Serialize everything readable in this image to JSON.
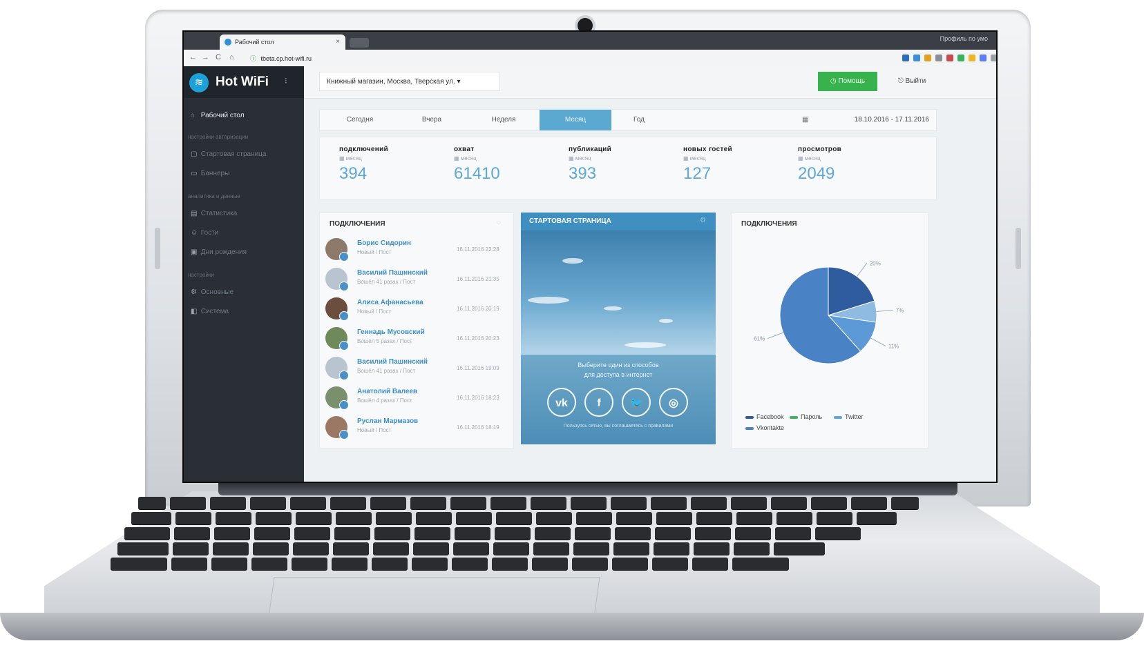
{
  "browser": {
    "tab_title": "Рабочий стол",
    "tab_close": "×",
    "profile": "Профиль по умо",
    "url": "tbeta.cp.hot-wifi.ru",
    "url_lock": "ⓘ",
    "nav": {
      "back": "←",
      "forward": "→",
      "reload": "C",
      "home": "⌂"
    },
    "extension_colors": [
      "#2d6db8",
      "#3b8fd9",
      "#e0a020",
      "#8a8f96",
      "#c94a4a",
      "#3db05b",
      "#f0b429",
      "#5c7cfa",
      "#9aa0a6"
    ]
  },
  "sidebar": {
    "logo_text": "Hot WiFi",
    "logo_icon": "wifi-icon",
    "menu_toggle": "⁝",
    "items": [
      {
        "label": "Рабочий стол",
        "icon": "home-icon",
        "active": true
      },
      {
        "section": "настройки авторизации"
      },
      {
        "label": "Стартовая страница",
        "icon": "page-icon"
      },
      {
        "label": "Баннеры",
        "icon": "banner-icon"
      },
      {
        "section": "аналитика и данные"
      },
      {
        "label": "Статистика",
        "icon": "chart-icon"
      },
      {
        "label": "Гости",
        "icon": "users-icon"
      },
      {
        "label": "Дни рождения",
        "icon": "cake-icon"
      },
      {
        "section": "настройки"
      },
      {
        "label": "Основные",
        "icon": "settings-icon"
      },
      {
        "label": "Система",
        "icon": "system-icon"
      }
    ]
  },
  "topbar": {
    "store_select": "Книжный магазин, Москва, Тверская ул.",
    "help_button": "Помощь",
    "logout_button": "Выйти"
  },
  "period": {
    "tabs": [
      "Сегодня",
      "Вчера",
      "Неделя",
      "Месяц",
      "Год"
    ],
    "active_tab": "Месяц",
    "date_range": "18.10.2016 - 17.11.2016"
  },
  "stats": [
    {
      "label": "подключений",
      "sub": "месяц",
      "value": "394"
    },
    {
      "label": "охват",
      "sub": "месяц",
      "value": "61410"
    },
    {
      "label": "публикаций",
      "sub": "месяц",
      "value": "393"
    },
    {
      "label": "новых гостей",
      "sub": "месяц",
      "value": "127"
    },
    {
      "label": "просмотров",
      "sub": "месяц",
      "value": "2049"
    }
  ],
  "connections_panel": {
    "title": "подключения",
    "rows": [
      {
        "name": "Борис Сидорин",
        "sub": "Новый / Пост",
        "time": "16.11.2016 22:28"
      },
      {
        "name": "Василий Пашинский",
        "sub": "Вошёл 41 разах / Пост",
        "time": "16.11.2016 21:35"
      },
      {
        "name": "Алиса Афанасьева",
        "sub": "Новый / Пост",
        "time": "16.11.2016 20:19"
      },
      {
        "name": "Геннадь Мусовский",
        "sub": "Вошёл 5 разах / Пост",
        "time": "16.11.2016 20:23"
      },
      {
        "name": "Василий Пашинский",
        "sub": "Вошёл 41 разах / Пост",
        "time": "16.11.2016 19:09"
      },
      {
        "name": "Анатолий Валеев",
        "sub": "Вошёл 4 разах / Пост",
        "time": "16.11.2016 18:23"
      },
      {
        "name": "Руслан Мармазов",
        "sub": "Новый / Пост",
        "time": "16.11.2016 18:19"
      }
    ]
  },
  "landing_panel": {
    "title": "стартовая страница",
    "text_line1": "Выберите один из способов",
    "text_line2": "для доступа в интернет",
    "socials": [
      "vk",
      "f",
      "twitter",
      "instagram"
    ],
    "social_glyphs": [
      "vk",
      "f",
      "🐦",
      "◎"
    ],
    "footer": "Пользуясь сетью, вы соглашаетесь с правилами"
  },
  "chart_panel": {
    "title": "подключения"
  },
  "chart_data": {
    "type": "pie",
    "title": "подключения",
    "slices": [
      {
        "name": "Facebook",
        "value": 20,
        "label": "20%",
        "color": "#2f5c9e"
      },
      {
        "name": "Пароль",
        "value": 7,
        "label": "7%",
        "color": "#8fbbe3"
      },
      {
        "name": "Twitter",
        "value": 11,
        "label": "11%",
        "color": "#5b9ad6"
      },
      {
        "name": "Vkontakte",
        "value": 61,
        "label": "61%",
        "color": "#4a82c6"
      }
    ],
    "legend": [
      "Facebook",
      "Пароль",
      "Twitter",
      "Vkontakte"
    ],
    "legend_colors": [
      "#2f5c9e",
      "#3cb55b",
      "#5ba7df",
      "#4a82c6"
    ],
    "legend_position": "bottom"
  }
}
